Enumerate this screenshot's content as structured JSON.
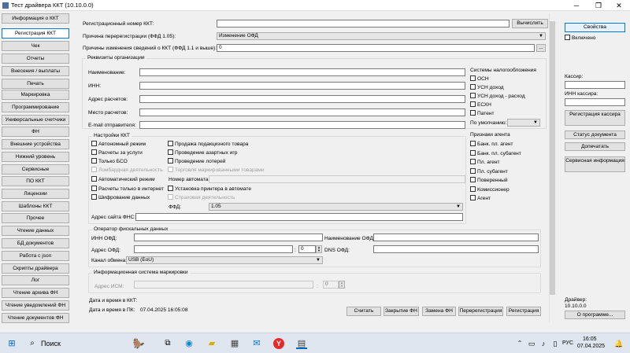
{
  "window": {
    "title": "Тест драйвера ККТ (10.10.0.0)",
    "minimize": "─",
    "maximize": "❐",
    "close": "✕"
  },
  "nav": [
    "Информация о ККТ",
    "Регистрация ККТ",
    "Чек",
    "Отчеты",
    "Внесения / выплаты",
    "Печать",
    "Маркировка",
    "Программирование",
    "Универсальные счетчики",
    "ФН",
    "Внешние устройства",
    "Нижний уровень",
    "Сервисные",
    "ПО ККТ",
    "Лицензии",
    "Шаблоны ККТ",
    "Прочее",
    "Чтение данных",
    "БД документов",
    "Работа с json",
    "Скрипты драйвера",
    "Лог",
    "Чтение архива ФН",
    "Чтение уведомлений ФН",
    "Чтение документов ФН"
  ],
  "nav_active_index": 1,
  "top": {
    "regnum_label": "Регистрационный номер ККТ:",
    "regnum_value": "",
    "calc_button": "Вычислить",
    "reason_label": "Причина перерегистрации (ФФД 1.05):",
    "reason_value": "Изменение ОФД",
    "changes_label": "Причины изменения сведений о ККТ (ФФД 1.1 и выше):",
    "changes_value": "0",
    "changes_button": "..."
  },
  "org": {
    "title": "Реквизиты организации",
    "name_label": "Наименование:",
    "inn_label": "ИНН:",
    "address_label": "Адрес расчетов:",
    "place_label": "Место расчетов:",
    "email_label": "E-mail отправителя:"
  },
  "tax": {
    "title": "Системы налогообложения",
    "items": [
      "ОСН",
      "УСН доход",
      "УСН доход - расход",
      "ЕСХН",
      "Патент"
    ],
    "default_label": "По умолчанию:"
  },
  "settings": {
    "title": "Настройки ККТ",
    "col1": [
      "Автономный режим",
      "Расчеты за услуги",
      "Только БСО"
    ],
    "col1_disabled": "Ломбардная деятельность",
    "col2": [
      "Продажа подакцизного товара",
      "Проведение азартных игр",
      "Проведение лотерей"
    ],
    "col2_disabled": "Торговля маркированными товарами",
    "auto_mode": "Автоматический режим",
    "automat_number_label": "Номер автомата:",
    "internet_only": "Расчеты только в интернет",
    "printer_in_automat": "Установка принтера в автомате",
    "encryption": "Шифрование данных",
    "insurance": "Страховая деятельность",
    "ffd_label": "ФФД:",
    "ffd_value": "1.05",
    "fns_site_label": "Адрес сайта ФНС:"
  },
  "agent": {
    "title": "Признаки агента",
    "items": [
      "Банк. пл. агент",
      "Банк. пл. субагент",
      "Пл. агент",
      "Пл. субагент",
      "Поверенный",
      "Комиссионер",
      "Агент"
    ]
  },
  "ofd": {
    "title": "Оператор фискальных данных",
    "inn_label": "ИНН ОФД:",
    "name_label": "Наименование ОФД:",
    "address_label": "Адрес ОФД:",
    "port_sep": ":",
    "port_value": "0",
    "dns_label": "DNS ОФД:",
    "channel_label": "Канал обмена:",
    "channel_value": "USB (EoU)"
  },
  "ism": {
    "title": "Информационная система маркировки",
    "address_label": "Адрес ИСМ:",
    "port_sep": ":",
    "port_value": "0"
  },
  "datetime": {
    "kkt_label": "Дата и время в ККТ:",
    "pc_label": "Дата и время в ПК:",
    "pc_value": "07.04.2025 16:05:08"
  },
  "bottom_buttons": [
    "Считать",
    "Закрытие ФН",
    "Замена ФН",
    "Перерегистрация",
    "Регистрация"
  ],
  "right": {
    "properties": "Свойства",
    "enabled": "Включено",
    "cashier_label": "Кассир:",
    "cashier_inn_label": "ИНН кассира:",
    "reg_cashier": "Регистрация кассира",
    "doc_status": "Статус документа",
    "finish_print": "Допечатать",
    "service_info": "Сервисная информация",
    "driver_label": "Драйвер:",
    "driver_version": "10.10.0.0",
    "about": "О программе..."
  },
  "taskbar": {
    "search": "Поиск",
    "lang": "РУС",
    "time": "16:05",
    "date": "07.04.2025"
  }
}
